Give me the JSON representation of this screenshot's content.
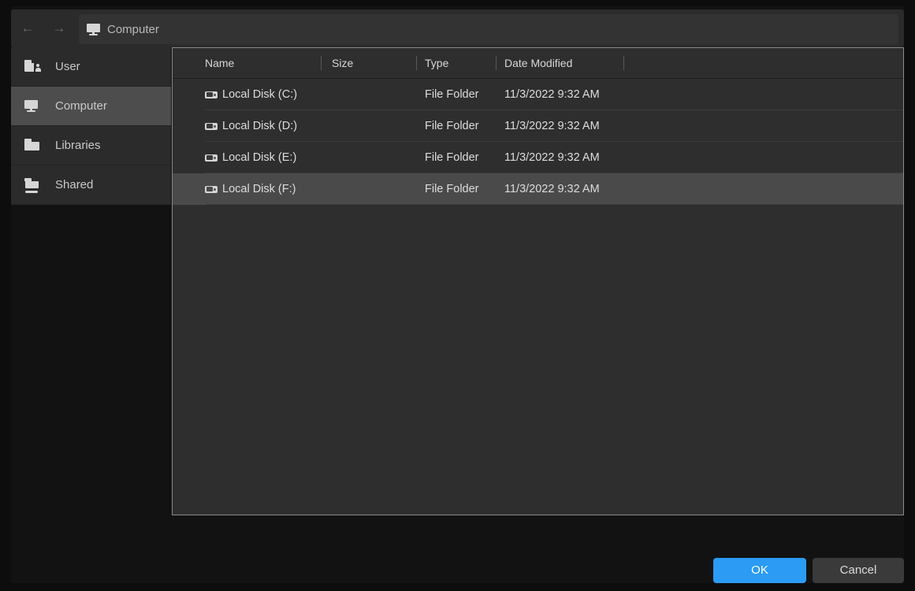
{
  "window": {
    "background": "#0d0d0d",
    "panel_background": "#2e2e2e"
  },
  "nav": {
    "back_icon": "arrow-left",
    "back_glyph": "←",
    "forward_icon": "arrow-right",
    "forward_glyph": "→",
    "breadcrumb": {
      "icon": "computer-monitor-icon",
      "label": "Computer"
    }
  },
  "sidebar": {
    "items": [
      {
        "label": "User",
        "icon": "user-folder-icon",
        "selected": false
      },
      {
        "label": "Computer",
        "icon": "computer-monitor-icon",
        "selected": true
      },
      {
        "label": "Libraries",
        "icon": "folder-icon",
        "selected": false
      },
      {
        "label": "Shared",
        "icon": "shared-folder-icon",
        "selected": false
      }
    ]
  },
  "filelist": {
    "columns": [
      {
        "label": "Name"
      },
      {
        "label": "Size"
      },
      {
        "label": "Type"
      },
      {
        "label": "Date Modified"
      }
    ],
    "rows": [
      {
        "icon": "hard-disk-icon",
        "name": "Local Disk (C:)",
        "size": "",
        "type": "File Folder",
        "date": "11/3/2022 9:32 AM",
        "selected": false
      },
      {
        "icon": "hard-disk-icon",
        "name": "Local Disk (D:)",
        "size": "",
        "type": "File Folder",
        "date": "11/3/2022 9:32 AM",
        "selected": false
      },
      {
        "icon": "hard-disk-icon",
        "name": "Local Disk (E:)",
        "size": "",
        "type": "File Folder",
        "date": "11/3/2022 9:32 AM",
        "selected": false
      },
      {
        "icon": "hard-disk-icon",
        "name": "Local Disk (F:)",
        "size": "",
        "type": "File Folder",
        "date": "11/3/2022 9:32 AM",
        "selected": true
      }
    ]
  },
  "footer": {
    "ok_label": "OK",
    "cancel_label": "Cancel",
    "ok_color": "#2b9bf4"
  }
}
